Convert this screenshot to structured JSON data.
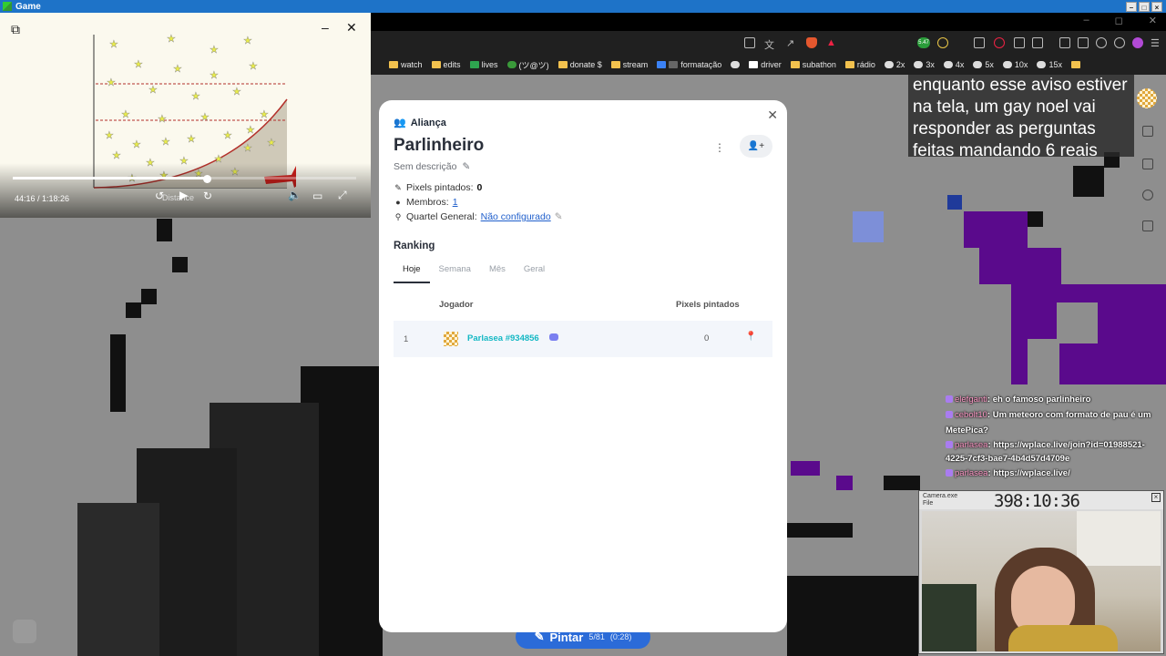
{
  "window": {
    "title": "Game"
  },
  "bookmarks": [
    {
      "label": "watch"
    },
    {
      "label": "edits"
    },
    {
      "label": "lives"
    },
    {
      "label": "(ツ@ツ)"
    },
    {
      "label": "donate $"
    },
    {
      "label": "stream"
    },
    {
      "label": "formatação"
    },
    {
      "label": "driver"
    },
    {
      "label": "subathon"
    },
    {
      "label": "rádio"
    },
    {
      "label": "2x"
    },
    {
      "label": "3x"
    },
    {
      "label": "4x"
    },
    {
      "label": "5x"
    },
    {
      "label": "10x"
    },
    {
      "label": "15x"
    }
  ],
  "toolbar": {
    "badge": "5.47"
  },
  "video": {
    "time": "44:16 / 1:18:26",
    "progress_fraction": 0.565,
    "overlay_text": "Distance"
  },
  "caption": {
    "text": "enquanto esse aviso estiver na tela, um gay noel vai responder as perguntas feitas mandando 6 reais"
  },
  "chat": [
    {
      "user": "elefganti",
      "message": ": eh o famoso parlinheiro"
    },
    {
      "user": "cebolt10",
      "message": ": Um meteoro com formato de pau é um MetePica?"
    },
    {
      "user": "parlasea",
      "message": ": https://wplace.live/join?id=01988521-4225-7cf3-bae7-4b4d57d4709e"
    },
    {
      "user": "parlasea",
      "message": ": https://wplace.live/"
    }
  ],
  "camera": {
    "title": "Camera.exe",
    "menu": "File",
    "timer": "398:10:36"
  },
  "pintar": {
    "label": "Pintar",
    "count": "5/81",
    "sub": "(0:28)"
  },
  "modal": {
    "header": "Aliança",
    "title": "Parlinheiro",
    "description": "Sem descrição",
    "stats": {
      "pixels_label": "Pixels pintados:",
      "pixels_value": "0",
      "members_label": "Membros:",
      "members_value": "1",
      "hq_label": "Quartel General:",
      "hq_value": "Não configurado"
    },
    "ranking_title": "Ranking",
    "tabs": [
      {
        "label": "Hoje"
      },
      {
        "label": "Semana"
      },
      {
        "label": "Mês"
      },
      {
        "label": "Geral"
      }
    ],
    "columns": {
      "player": "Jogador",
      "pixels": "Pixels pintados"
    },
    "rows": [
      {
        "rank": "1",
        "name": "Parlasea #934856",
        "pixels": "0"
      }
    ]
  },
  "colors": {
    "accent": "#14b8c4",
    "link": "#1f5fcc",
    "pintar": "#2b6bd8",
    "purple": "#5a0a8c"
  }
}
